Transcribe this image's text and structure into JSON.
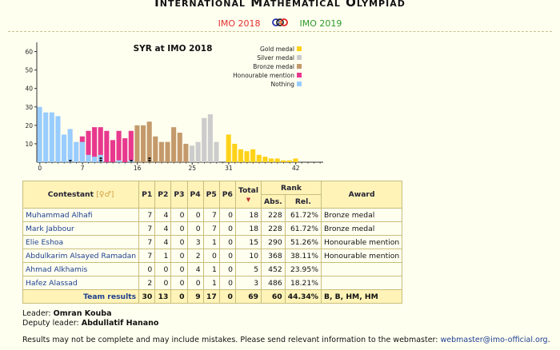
{
  "header": {
    "title_parts": [
      [
        "I",
        "NTERNATIONAL"
      ],
      [
        "M",
        "ATHEMATICAL"
      ],
      [
        "O",
        "LYMPIAD"
      ]
    ],
    "prev_link": "IMO 2018",
    "next_link": "IMO 2019",
    "logo_icon": "imo-logo-icon"
  },
  "chart_data": {
    "type": "bar",
    "title": "SYR at IMO 2018",
    "xlabel": "",
    "ylabel": "",
    "ylim": [
      0,
      65
    ],
    "yticks": [
      10,
      20,
      30,
      40,
      50,
      60
    ],
    "xticks": [
      0,
      7,
      16,
      25,
      31,
      42
    ],
    "xlim": [
      0,
      46
    ],
    "x": [
      0,
      1,
      2,
      3,
      4,
      5,
      6,
      7,
      8,
      9,
      10,
      11,
      12,
      13,
      14,
      15,
      16,
      17,
      18,
      19,
      20,
      21,
      22,
      23,
      24,
      25,
      26,
      27,
      28,
      29,
      30,
      31,
      32,
      33,
      34,
      35,
      36,
      37,
      38,
      39,
      40,
      41,
      42,
      43,
      44,
      45,
      46
    ],
    "series": [
      {
        "name": "Gold medal",
        "color": "#ffd21a",
        "values": [
          0,
          0,
          0,
          0,
          0,
          0,
          0,
          0,
          0,
          0,
          0,
          0,
          0,
          0,
          0,
          0,
          0,
          0,
          0,
          0,
          0,
          0,
          0,
          0,
          0,
          0,
          0,
          0,
          0,
          0,
          0,
          15,
          10,
          7,
          6,
          7,
          4,
          3,
          2,
          2,
          1,
          1,
          2,
          0,
          0,
          0,
          0
        ]
      },
      {
        "name": "Silver medal",
        "color": "#cccccc",
        "values": [
          0,
          0,
          0,
          0,
          0,
          0,
          0,
          0,
          0,
          0,
          0,
          0,
          0,
          0,
          0,
          0,
          0,
          0,
          0,
          0,
          0,
          0,
          0,
          0,
          0,
          9,
          11,
          24,
          26,
          11,
          0,
          0,
          0,
          0,
          0,
          0,
          0,
          0,
          0,
          0,
          0,
          0,
          0,
          0,
          0,
          0,
          0
        ]
      },
      {
        "name": "Bronze medal",
        "color": "#c49a6c",
        "values": [
          0,
          0,
          0,
          0,
          0,
          0,
          0,
          0,
          0,
          0,
          0,
          0,
          0,
          0,
          0,
          0,
          20,
          20,
          22,
          14,
          11,
          11,
          19,
          16,
          10,
          0,
          0,
          0,
          0,
          0,
          0,
          0,
          0,
          0,
          0,
          0,
          0,
          0,
          0,
          0,
          0,
          0,
          0,
          0,
          0,
          0,
          0
        ]
      },
      {
        "name": "Honourable mention",
        "color": "#e8388e",
        "values": [
          0,
          0,
          0,
          0,
          0,
          0,
          0,
          14,
          17,
          19,
          19,
          17,
          12,
          17,
          13,
          17,
          0,
          0,
          0,
          0,
          0,
          0,
          0,
          0,
          0,
          0,
          0,
          0,
          0,
          0,
          0,
          0,
          0,
          0,
          0,
          0,
          0,
          0,
          0,
          0,
          0,
          0,
          0,
          0,
          0,
          0,
          0
        ]
      },
      {
        "name": "Nothing",
        "color": "#99ccff",
        "values": [
          30,
          27,
          27,
          25,
          15,
          18,
          11,
          11,
          4,
          3,
          4,
          0,
          0,
          1,
          0,
          1,
          0,
          0,
          0,
          0,
          0,
          0,
          0,
          0,
          0,
          0,
          0,
          0,
          0,
          0,
          0,
          0,
          0,
          0,
          0,
          0,
          0,
          0,
          0,
          0,
          0,
          0,
          0,
          0,
          0,
          0,
          0
        ]
      }
    ],
    "country_marks": [
      5,
      10,
      10,
      15,
      18,
      18
    ],
    "legend_position": "top-right",
    "grid": false
  },
  "table": {
    "columns": {
      "contestant": "Contestant",
      "sort_hint": "[♀♂]",
      "problems": [
        "P1",
        "P2",
        "P3",
        "P4",
        "P5",
        "P6"
      ],
      "total": "Total",
      "rank": "Rank",
      "abs": "Abs.",
      "rel": "Rel.",
      "award": "Award"
    },
    "rows": [
      {
        "name": "Muhammad Alhafi",
        "scores": [
          "7",
          "4",
          "0",
          "0",
          "7",
          "0"
        ],
        "total": "18",
        "abs": "228",
        "rel": "61.72%",
        "award": "Bronze medal"
      },
      {
        "name": "Mark Jabbour",
        "scores": [
          "7",
          "4",
          "0",
          "0",
          "7",
          "0"
        ],
        "total": "18",
        "abs": "228",
        "rel": "61.72%",
        "award": "Bronze medal"
      },
      {
        "name": "Elie Eshoa",
        "scores": [
          "7",
          "4",
          "0",
          "3",
          "1",
          "0"
        ],
        "total": "15",
        "abs": "290",
        "rel": "51.26%",
        "award": "Honourable mention"
      },
      {
        "name": "Abdulkarim Alsayed Ramadan",
        "scores": [
          "7",
          "1",
          "0",
          "2",
          "0",
          "0"
        ],
        "total": "10",
        "abs": "368",
        "rel": "38.11%",
        "award": "Honourable mention"
      },
      {
        "name": "Ahmad Alkhamis",
        "scores": [
          "0",
          "0",
          "0",
          "4",
          "1",
          "0"
        ],
        "total": "5",
        "abs": "452",
        "rel": "23.95%",
        "award": ""
      },
      {
        "name": "Hafez Alassad",
        "scores": [
          "2",
          "0",
          "0",
          "0",
          "1",
          "0"
        ],
        "total": "3",
        "abs": "486",
        "rel": "18.21%",
        "award": ""
      }
    ],
    "team": {
      "label": "Team results",
      "scores": [
        "30",
        "13",
        "0",
        "9",
        "17",
        "0"
      ],
      "total": "69",
      "abs": "60",
      "rel": "44.34%",
      "award": "B, B, HM, HM"
    }
  },
  "leaders": {
    "leader_label": "Leader:",
    "leader_name": "Omran Kouba",
    "deputy_label": "Deputy leader:",
    "deputy_name": "Abdullatif Hanano"
  },
  "footer": {
    "text": "Results may not be complete and may include mistakes. Please send relevant information to the webmaster:",
    "email": "webmaster@imo-official.org",
    "suffix": "."
  }
}
